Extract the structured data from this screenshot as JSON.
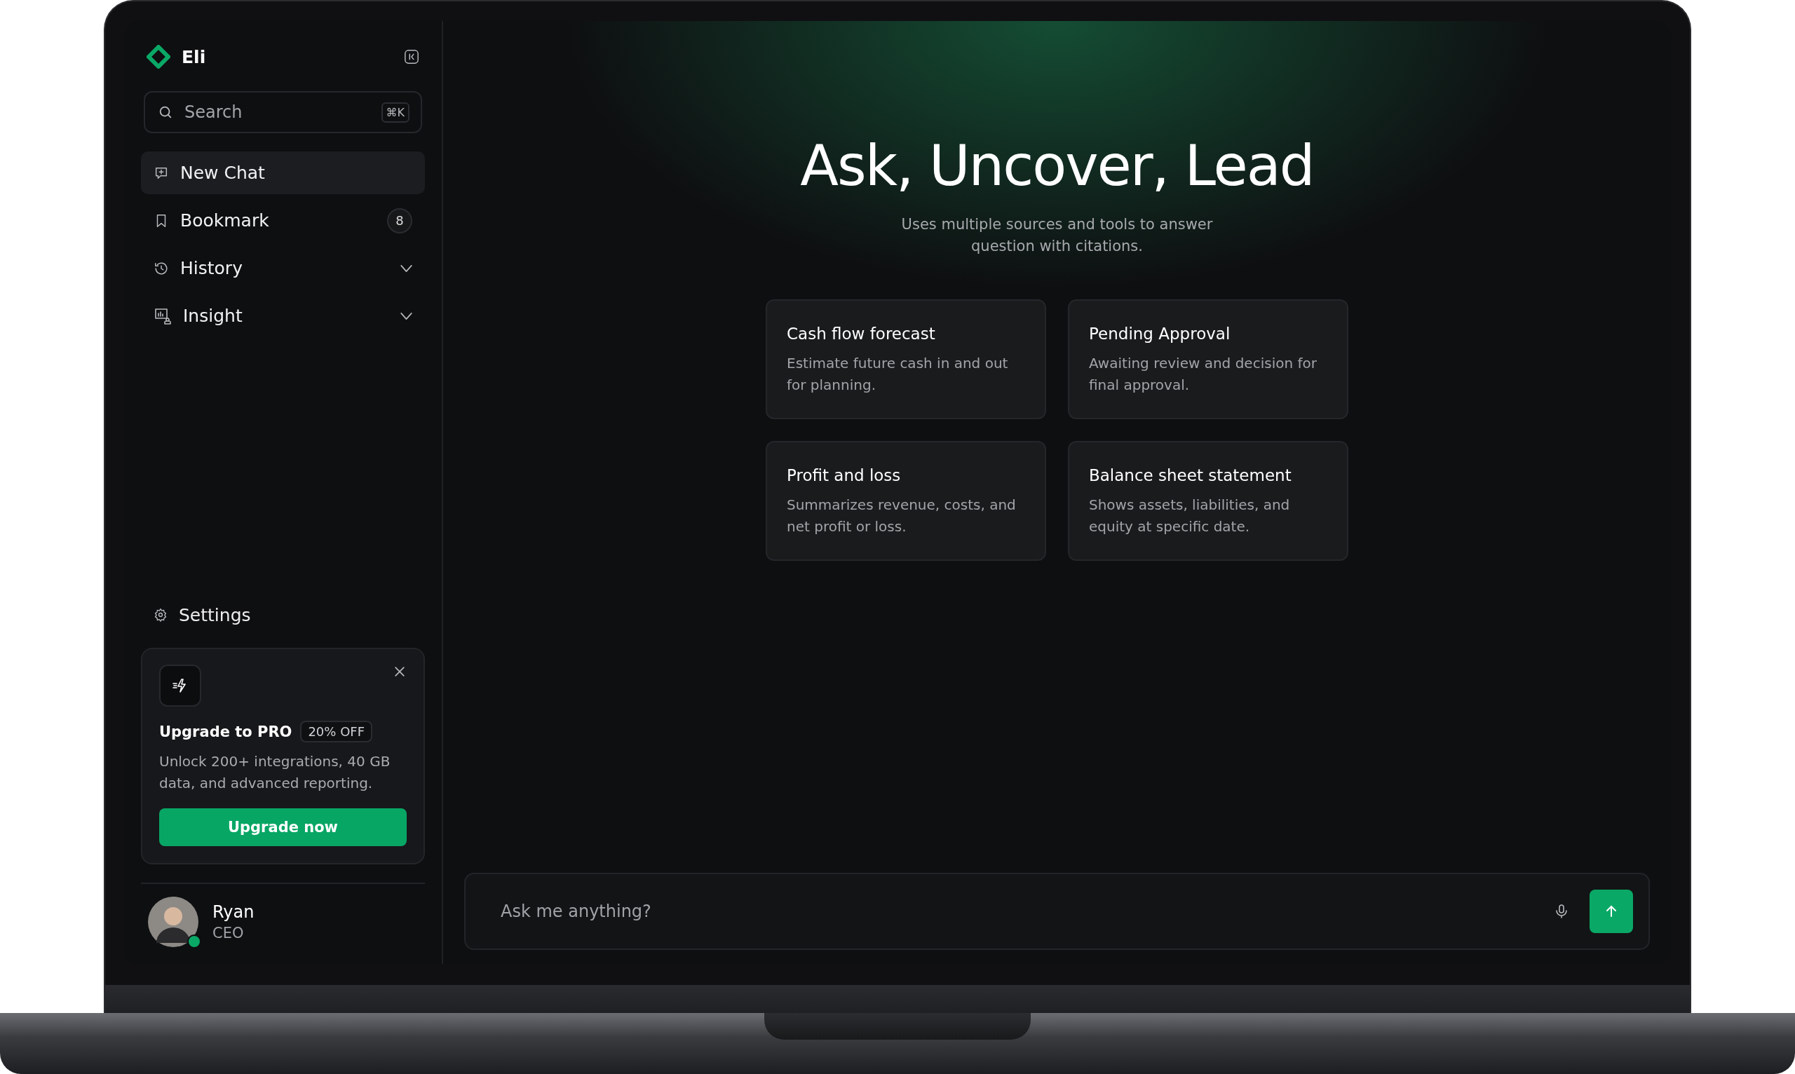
{
  "sidebar": {
    "brand": "Eli",
    "search": {
      "placeholder": "Search",
      "shortcut": "⌘K"
    },
    "items": [
      {
        "label": "New Chat",
        "selected": true
      },
      {
        "label": "Bookmark",
        "selected": false,
        "badge": "8"
      },
      {
        "label": "History",
        "selected": false,
        "expanded": false
      },
      {
        "label": "Insight",
        "selected": false,
        "expanded": false
      }
    ],
    "settings": {
      "label": "Settings"
    },
    "promo": {
      "title": "Upgrade to PRO",
      "tag": "20% OFF",
      "text": "Unlock 200+ integrations, 40 GB data, and advanced reporting.",
      "button": "Upgrade now"
    },
    "user": {
      "name": "Ryan",
      "role": "CEO",
      "online": true
    }
  },
  "main": {
    "heading": "Ask, Uncover, Lead",
    "subtitle": "Uses multiple sources and tools to answer question with citations.",
    "cards": [
      {
        "title": "Cash flow forecast",
        "text": "Estimate future cash in and out for planning."
      },
      {
        "title": "Pending Approval",
        "text": "Awaiting review and decision for final approval."
      },
      {
        "title": "Profit and loss",
        "text": "Summarizes revenue, costs, and net profit or loss."
      },
      {
        "title": "Balance sheet statement",
        "text": "Shows assets, liabilities, and equity at specific date."
      }
    ],
    "prompt": {
      "placeholder": "Ask me anything?"
    }
  }
}
